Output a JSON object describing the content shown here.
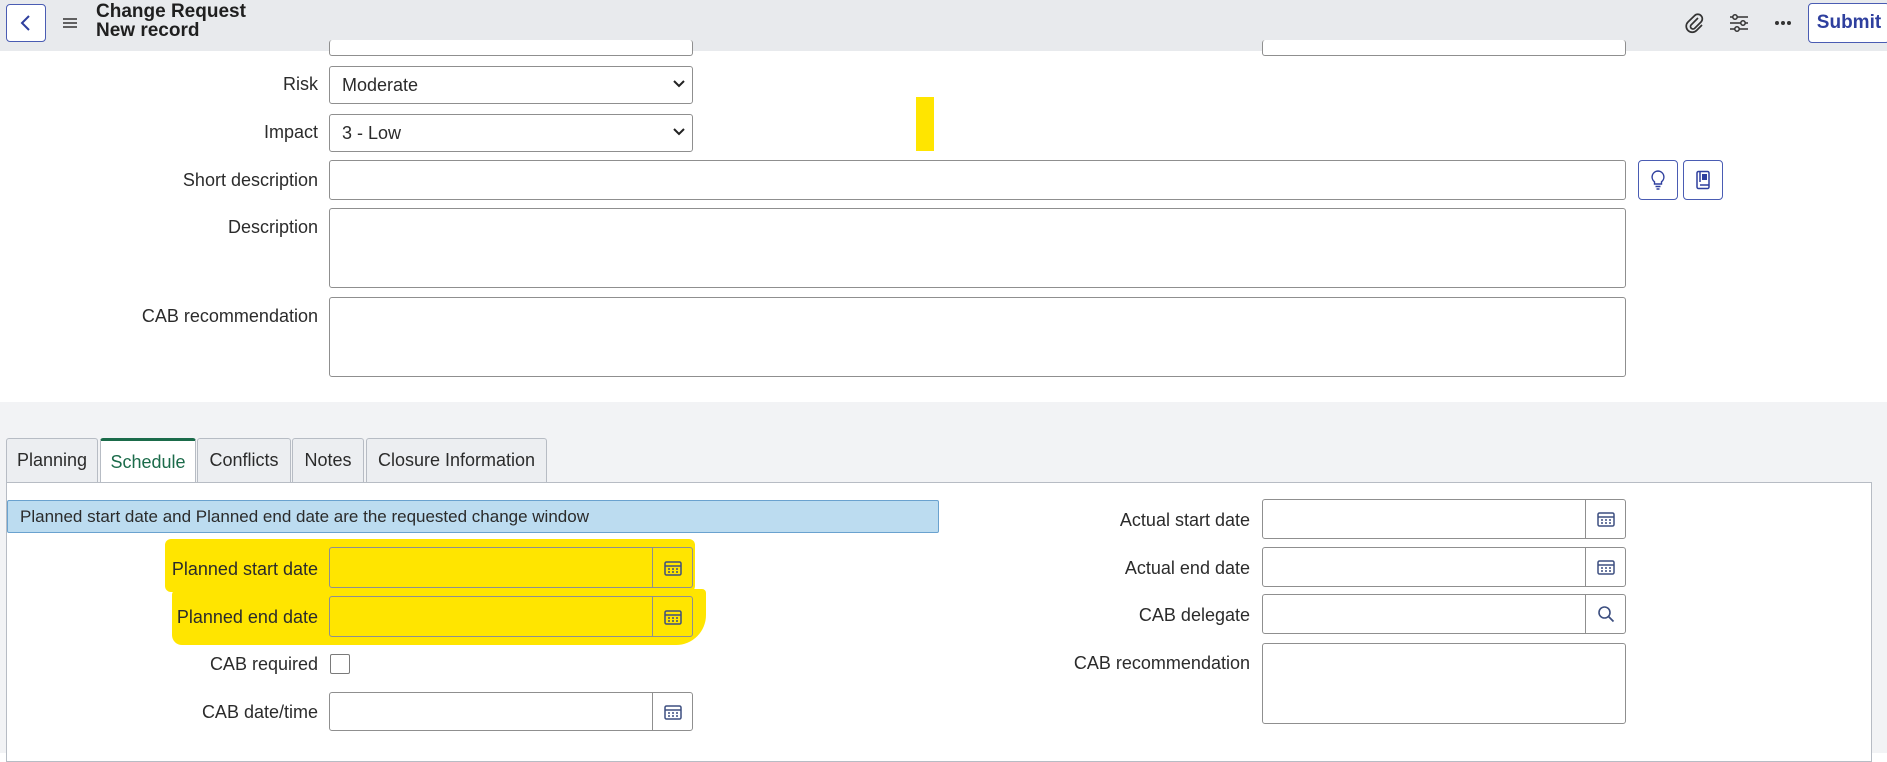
{
  "header": {
    "title": "Change Request",
    "subtitle": "New record",
    "submit_label": "Submit"
  },
  "form": {
    "risk": {
      "label": "Risk",
      "value": "Moderate"
    },
    "impact": {
      "label": "Impact",
      "value": "3 - Low"
    },
    "short_description": {
      "label": "Short description",
      "value": ""
    },
    "description": {
      "label": "Description",
      "value": ""
    },
    "cab_recommendation": {
      "label": "CAB recommendation",
      "value": ""
    }
  },
  "tabs": [
    {
      "label": "Planning"
    },
    {
      "label": "Schedule"
    },
    {
      "label": "Conflicts"
    },
    {
      "label": "Notes"
    },
    {
      "label": "Closure Information"
    }
  ],
  "schedule": {
    "info_message": "Planned start date and Planned end date are the requested change window",
    "planned_start": {
      "label": "Planned start date",
      "value": ""
    },
    "planned_end": {
      "label": "Planned end date",
      "value": ""
    },
    "cab_required": {
      "label": "CAB required",
      "checked": false
    },
    "cab_datetime": {
      "label": "CAB date/time",
      "value": ""
    },
    "actual_start": {
      "label": "Actual start date",
      "value": ""
    },
    "actual_end": {
      "label": "Actual end date",
      "value": ""
    },
    "cab_delegate": {
      "label": "CAB delegate",
      "value": ""
    },
    "cab_recommendation": {
      "label": "CAB recommendation",
      "value": ""
    }
  },
  "colors": {
    "accent": "#2e3f9e",
    "active_tab": "#1b6b4a",
    "highlight": "#ffe500",
    "info_bg": "#bcdcf0"
  },
  "icons": [
    "chevron-left-icon",
    "menu-icon",
    "paperclip-icon",
    "sliders-icon",
    "more-icon",
    "lightbulb-icon",
    "book-icon",
    "calendar-icon",
    "search-icon",
    "chevron-down-icon"
  ]
}
